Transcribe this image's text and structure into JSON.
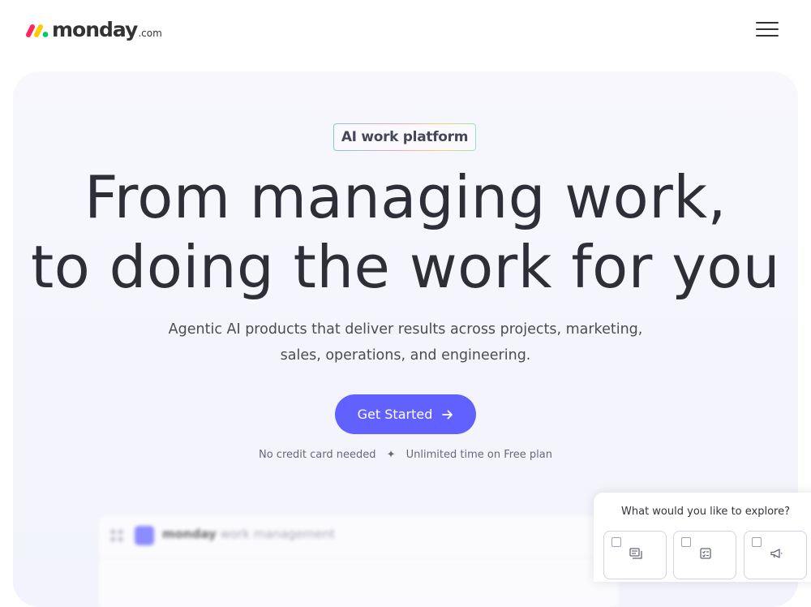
{
  "header": {
    "logo_word": "monday",
    "logo_tld": ".com",
    "logo_colors": [
      "#fb275d",
      "#ffcb00",
      "#00ca72"
    ],
    "menu_icon": "hamburger-menu-icon"
  },
  "hero": {
    "badge": "AI work platform",
    "headline_line1": "From managing work,",
    "headline_line2": "to doing the work for you",
    "subtitle_line1": "Agentic AI products that deliver results across projects, marketing,",
    "subtitle_line2": "sales, operations, and engineering.",
    "cta_label": "Get Started",
    "cta_icon": "arrow-right-icon",
    "cta_color": "#6161ff",
    "fine_print_left": "No credit card needed",
    "fine_print_separator": "✦",
    "fine_print_right": "Unlimited time on Free plan"
  },
  "preview": {
    "brand": "monday",
    "product": "work management"
  },
  "explore": {
    "title": "What would you like to explore?",
    "cards": [
      {
        "icon": "chat-stack-icon"
      },
      {
        "icon": "checklist-icon"
      },
      {
        "icon": "megaphone-icon"
      }
    ]
  }
}
